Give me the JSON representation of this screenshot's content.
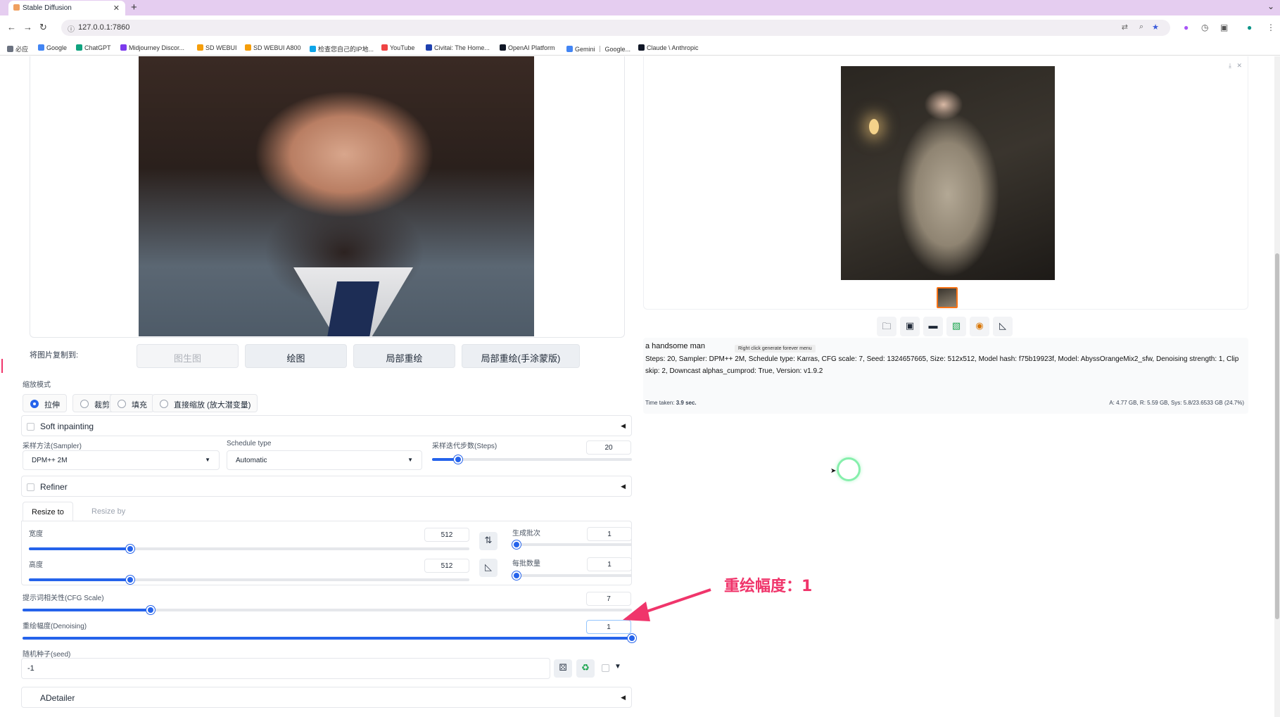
{
  "browser": {
    "tab_title": "Stable Diffusion",
    "url": "127.0.0.1:7860",
    "bookmarks": [
      {
        "label": "必应",
        "color": "#6b7280"
      },
      {
        "label": "Google",
        "color": "#4285f4"
      },
      {
        "label": "ChatGPT",
        "color": "#10a37f"
      },
      {
        "label": "Midjourney Discor...",
        "color": "#7c3aed"
      },
      {
        "label": "SD WEBUI",
        "color": "#f59e0b"
      },
      {
        "label": "SD WEBUI A800",
        "color": "#f59e0b"
      },
      {
        "label": "检查您自己的IP地...",
        "color": "#0ea5e9"
      },
      {
        "label": "YouTube",
        "color": "#ef4444"
      },
      {
        "label": "Civitai: The Home...",
        "color": "#1e40af"
      },
      {
        "label": "OpenAI Platform",
        "color": "#111827"
      },
      {
        "label": "Gemini ｜ Google...",
        "color": "#4285f4"
      },
      {
        "label": "Claude \\ Anthropic",
        "color": "#111827"
      }
    ]
  },
  "img2img": {
    "copy_label": "将图片复制到:",
    "copy_buttons": [
      "图生图",
      "绘图",
      "局部重绘",
      "局部重绘(手涂蒙版)"
    ],
    "resize_mode_label": "缩放模式",
    "resize_modes": [
      "拉伸",
      "裁剪",
      "填充",
      "直接缩放 (放大潜变量)"
    ],
    "soft_inpainting": "Soft inpainting",
    "sampler_label": "采样方法(Sampler)",
    "sampler_value": "DPM++ 2M",
    "schedule_label": "Schedule type",
    "schedule_value": "Automatic",
    "steps_label": "采样迭代步数(Steps)",
    "steps_value": "20",
    "steps_fraction": 0.13,
    "refiner": "Refiner",
    "resize_tabs": [
      "Resize to",
      "Resize by"
    ],
    "width_label": "宽度",
    "width_value": "512",
    "width_fraction": 0.23,
    "height_label": "高度",
    "height_value": "512",
    "height_fraction": 0.23,
    "batch_count_label": "生成批次",
    "batch_count_value": "1",
    "batch_count_fraction": 0.0,
    "batch_size_label": "每批数量",
    "batch_size_value": "1",
    "batch_size_fraction": 0.0,
    "cfg_label": "提示词相关性(CFG Scale)",
    "cfg_value": "7",
    "cfg_fraction": 0.21,
    "denoise_label": "重绘幅度(Denoising)",
    "denoise_value": "1",
    "denoise_fraction": 1.0,
    "seed_label": "随机种子(seed)",
    "seed_value": "-1",
    "adetailer": "ADetailer"
  },
  "output": {
    "prompt": "a handsome man",
    "params": "Steps: 20, Sampler: DPM++ 2M, Schedule type: Karras, CFG scale: 7, Seed: 1324657665, Size: 512x512, Model hash: f75b19923f, Model: AbyssOrangeMix2_sfw, Denoising strength: 1, Clip skip: 2, Downcast alphas_cumprod: True, Version: v1.9.2",
    "tooltip": "Right click generate forever menu",
    "time_taken_label": "Time taken:",
    "time_taken_value": "3.9 sec.",
    "vram": "A: 4.77 GB, R: 5.59 GB, Sys: 5.8/23.6533 GB (24.7%)"
  },
  "annotation": {
    "text": "重绘幅度：1",
    "color": "#f0356b"
  }
}
